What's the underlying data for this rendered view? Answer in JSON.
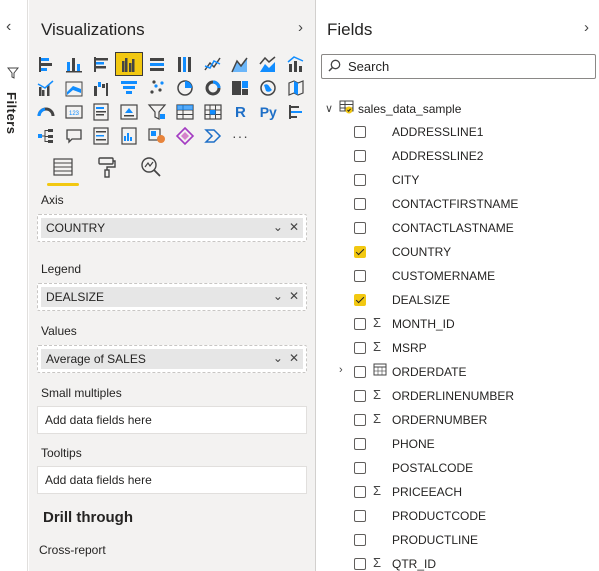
{
  "filters": {
    "title": "Filters",
    "expand_icon": "chevron-left-icon",
    "funnel_icon": "funnel-icon"
  },
  "visualizations": {
    "title": "Visualizations",
    "collapse_icon": "chevron-right-icon",
    "tabs": [
      {
        "name": "fields-tab",
        "icon": "fields-icon",
        "active": true
      },
      {
        "name": "format-tab",
        "icon": "paint-roller-icon",
        "active": false
      },
      {
        "name": "analytics-tab",
        "icon": "magnifier-chart-icon",
        "active": false
      }
    ],
    "wells": {
      "axis": {
        "label": "Axis",
        "value": "COUNTRY"
      },
      "legend": {
        "label": "Legend",
        "value": "DEALSIZE"
      },
      "values": {
        "label": "Values",
        "value": "Average of SALES"
      },
      "small_multiples": {
        "label": "Small multiples",
        "placeholder": "Add data fields here"
      },
      "tooltips": {
        "label": "Tooltips",
        "placeholder": "Add data fields here"
      }
    },
    "drill_through": {
      "title": "Drill through",
      "cross_report": "Cross-report"
    },
    "r_label": "R",
    "py_label": "Py",
    "more_label": "···"
  },
  "fields": {
    "title": "Fields",
    "collapse_icon": "chevron-right-icon",
    "search_placeholder": "Search",
    "table_name": "sales_data_sample",
    "items": [
      {
        "name": "ADDRESSLINE1",
        "type": "",
        "checked": false,
        "expandable": false
      },
      {
        "name": "ADDRESSLINE2",
        "type": "",
        "checked": false,
        "expandable": false
      },
      {
        "name": "CITY",
        "type": "",
        "checked": false,
        "expandable": false
      },
      {
        "name": "CONTACTFIRSTNAME",
        "type": "",
        "checked": false,
        "expandable": false
      },
      {
        "name": "CONTACTLASTNAME",
        "type": "",
        "checked": false,
        "expandable": false
      },
      {
        "name": "COUNTRY",
        "type": "",
        "checked": true,
        "expandable": false
      },
      {
        "name": "CUSTOMERNAME",
        "type": "",
        "checked": false,
        "expandable": false
      },
      {
        "name": "DEALSIZE",
        "type": "",
        "checked": true,
        "expandable": false
      },
      {
        "name": "MONTH_ID",
        "type": "sum",
        "checked": false,
        "expandable": false
      },
      {
        "name": "MSRP",
        "type": "sum",
        "checked": false,
        "expandable": false
      },
      {
        "name": "ORDERDATE",
        "type": "date",
        "checked": false,
        "expandable": true
      },
      {
        "name": "ORDERLINENUMBER",
        "type": "sum",
        "checked": false,
        "expandable": false
      },
      {
        "name": "ORDERNUMBER",
        "type": "sum",
        "checked": false,
        "expandable": false
      },
      {
        "name": "PHONE",
        "type": "",
        "checked": false,
        "expandable": false
      },
      {
        "name": "POSTALCODE",
        "type": "",
        "checked": false,
        "expandable": false
      },
      {
        "name": "PRICEEACH",
        "type": "sum",
        "checked": false,
        "expandable": false
      },
      {
        "name": "PRODUCTCODE",
        "type": "",
        "checked": false,
        "expandable": false
      },
      {
        "name": "PRODUCTLINE",
        "type": "",
        "checked": false,
        "expandable": false
      },
      {
        "name": "QTR_ID",
        "type": "sum",
        "checked": false,
        "expandable": false
      }
    ]
  },
  "colors": {
    "accent": "#f2c811",
    "pane_bg": "#f3f2f1",
    "icon_blue": "#118dff",
    "icon_dark": "#3b3a39"
  }
}
